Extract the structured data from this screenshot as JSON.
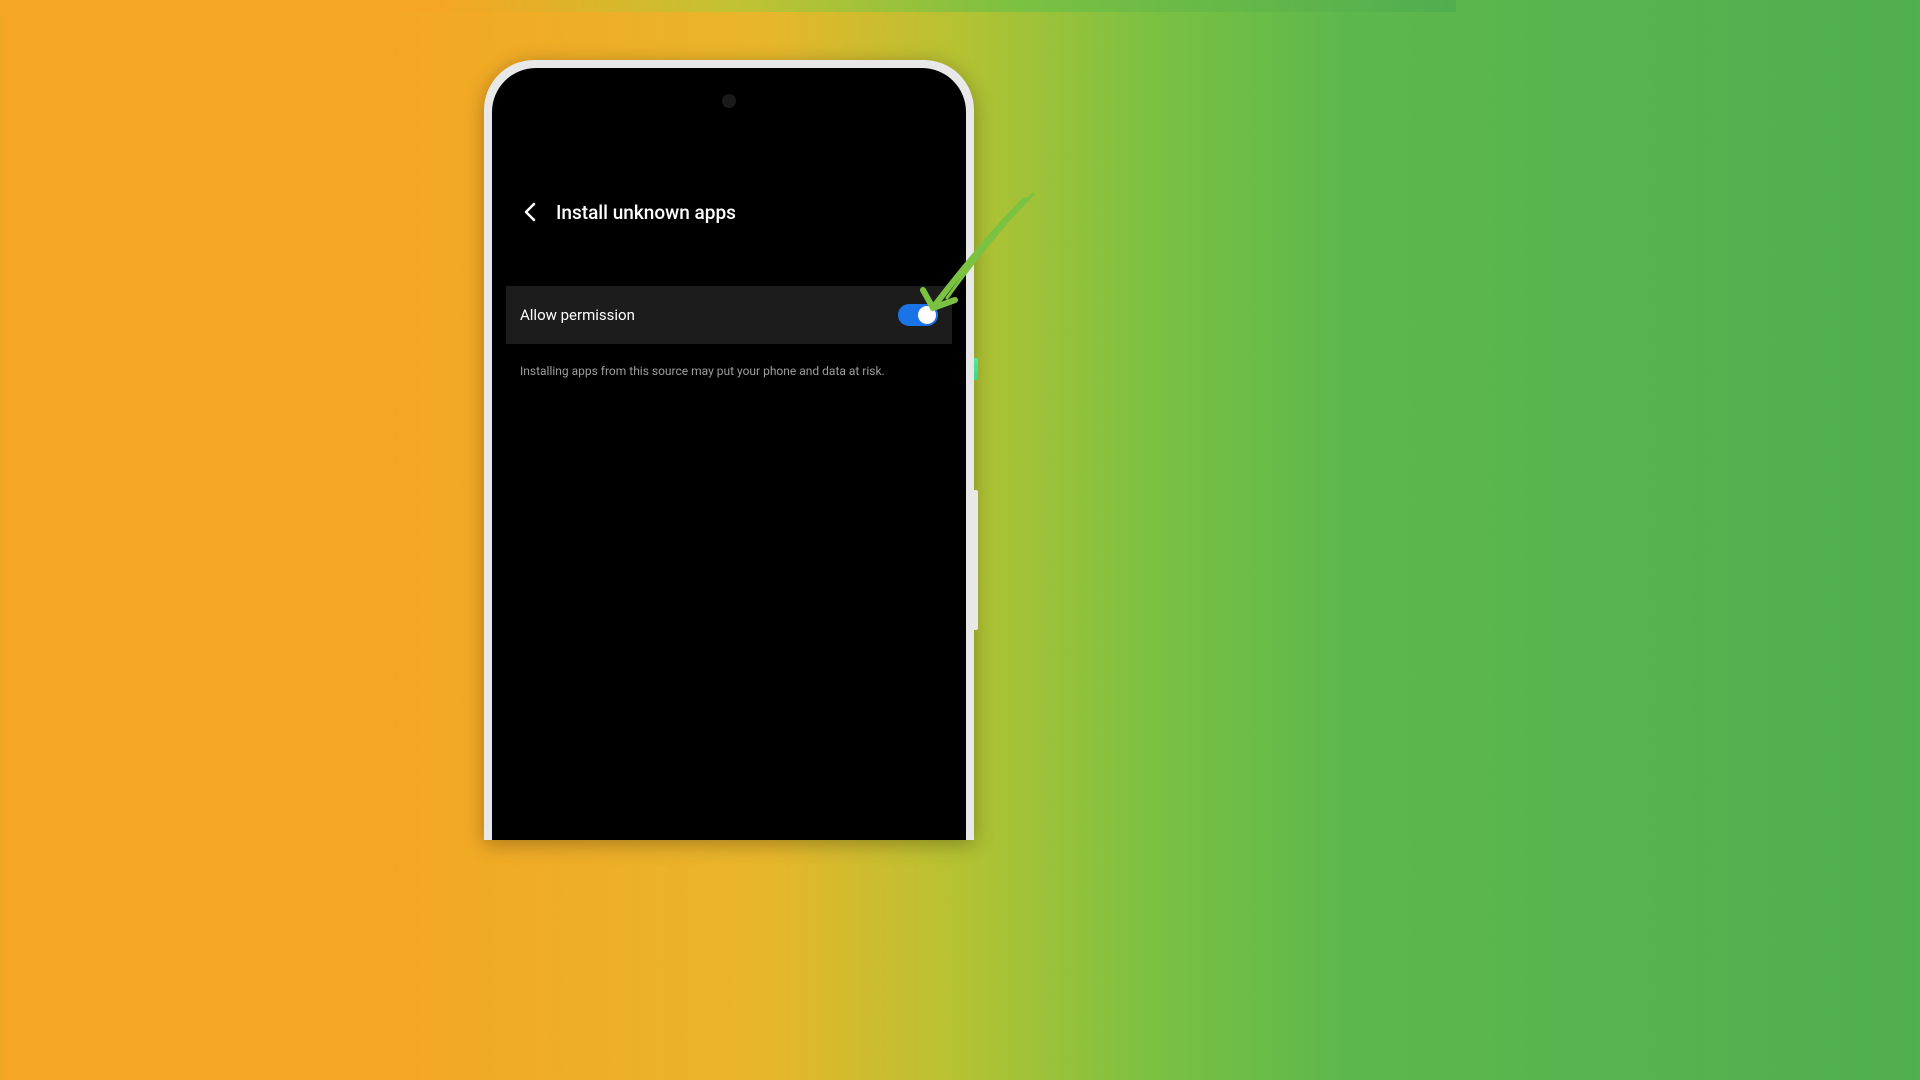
{
  "header": {
    "title": "Install unknown apps"
  },
  "setting": {
    "label": "Allow permission",
    "enabled": true
  },
  "warning": "Installing apps from this source may put your phone and data at risk."
}
